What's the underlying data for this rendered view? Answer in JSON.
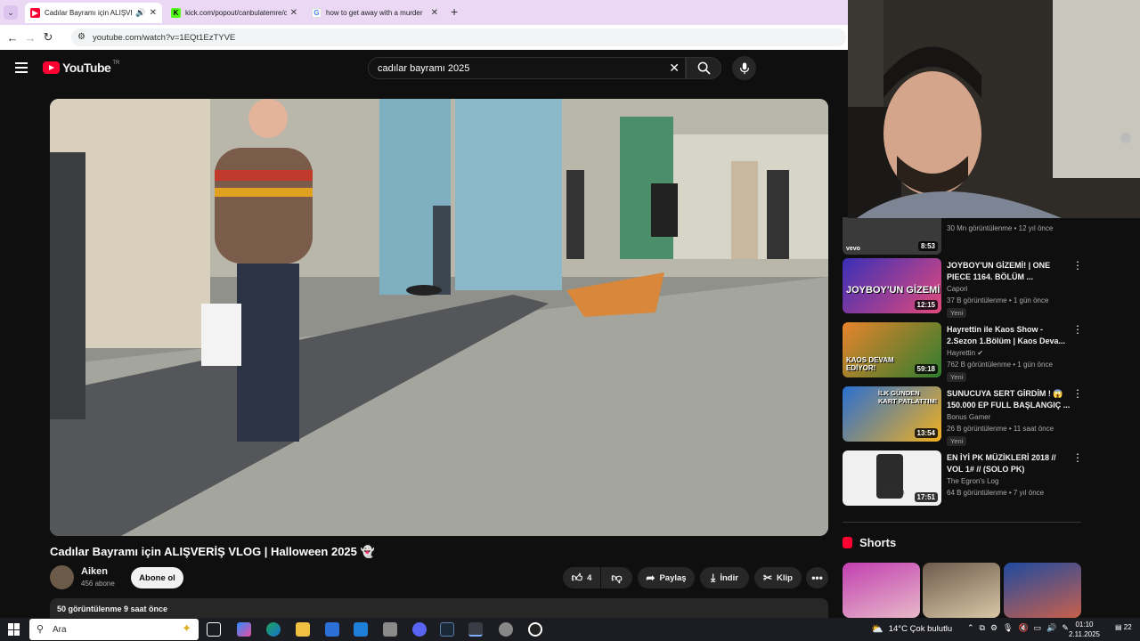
{
  "browser": {
    "tabs": [
      {
        "title": "Cadılar Bayramı için ALIŞVERİŞ",
        "active": true
      },
      {
        "title": "kick.com/popout/canbulatemre/chat",
        "active": false
      },
      {
        "title": "how to get away with a murder",
        "active": false
      }
    ],
    "url": "youtube.com/watch?v=1EQt1EzTYVE"
  },
  "youtube": {
    "logo_text": "YouTube",
    "logo_sup": "TR",
    "search_value": "cadılar bayramı 2025"
  },
  "video": {
    "title": "Cadılar Bayramı için ALIŞVERİŞ VLOG | Halloween 2025 👻",
    "channel": "Aiken",
    "subscribers": "456 abone",
    "subscribe_label": "Abone ol",
    "likes": "4",
    "share_label": "Paylaş",
    "download_label": "İndir",
    "clip_label": "Klip",
    "views_time": "50 görüntülenme  9 saat önce"
  },
  "sidebar": {
    "partial": {
      "duration": "8:53",
      "badge": "vevo",
      "meta": "30 Mn görüntülenme • 12 yıl önce"
    },
    "items": [
      {
        "title": "JOYBOY'UN GİZEMİ! | ONE PIECE 1164. BÖLÜM ...",
        "channel": "Capori",
        "meta": "37 B görüntülenme • 1 gün önce",
        "badge": "Yeni",
        "duration": "12:15",
        "thumb_text": "JOYBOY'UN GİZEMİ",
        "colors": [
          "#3a2fb8",
          "#e34a7a"
        ]
      },
      {
        "title": "Hayrettin ile Kaos Show - 2.Sezon 1.Bölüm | Kaos Deva...",
        "channel": "Hayrettin ✔",
        "meta": "762 B görüntülenme • 1 gün önce",
        "badge": "Yeni",
        "duration": "59:18",
        "thumb_text": "KAOS DEVAM EDİYOR!",
        "colors": [
          "#e8842b",
          "#2e7d2e"
        ]
      },
      {
        "title": "SUNUCUYA SERT GİRDİM ! 😱 150.000 EP FULL BAŞLANGIÇ ...",
        "channel": "Bonus Gamer",
        "meta": "26 B görüntülenme • 11 saat önce",
        "badge": "Yeni",
        "duration": "13:54",
        "thumb_text": "İLK GÜNDEN KART PATLATTIM!",
        "colors": [
          "#2a6fd1",
          "#f2b01e"
        ]
      },
      {
        "title": "EN İYİ PK MÜZİKLERİ 2018 // VOL 1# // (SOLO PK)",
        "channel": "The Egron's Log",
        "meta": "64 B görüntülenme • 7 yıl önce",
        "badge": "",
        "duration": "17:51",
        "thumb_text": "The 's Log",
        "colors": [
          "#f0f0f0",
          "#2b2b2b"
        ]
      }
    ],
    "shorts_label": "Shorts"
  },
  "taskbar": {
    "search_placeholder": "Ara",
    "weather": "14°C  Çok bulutlu",
    "time": "01:10",
    "date": "2.11.2025",
    "notifications": "22"
  }
}
